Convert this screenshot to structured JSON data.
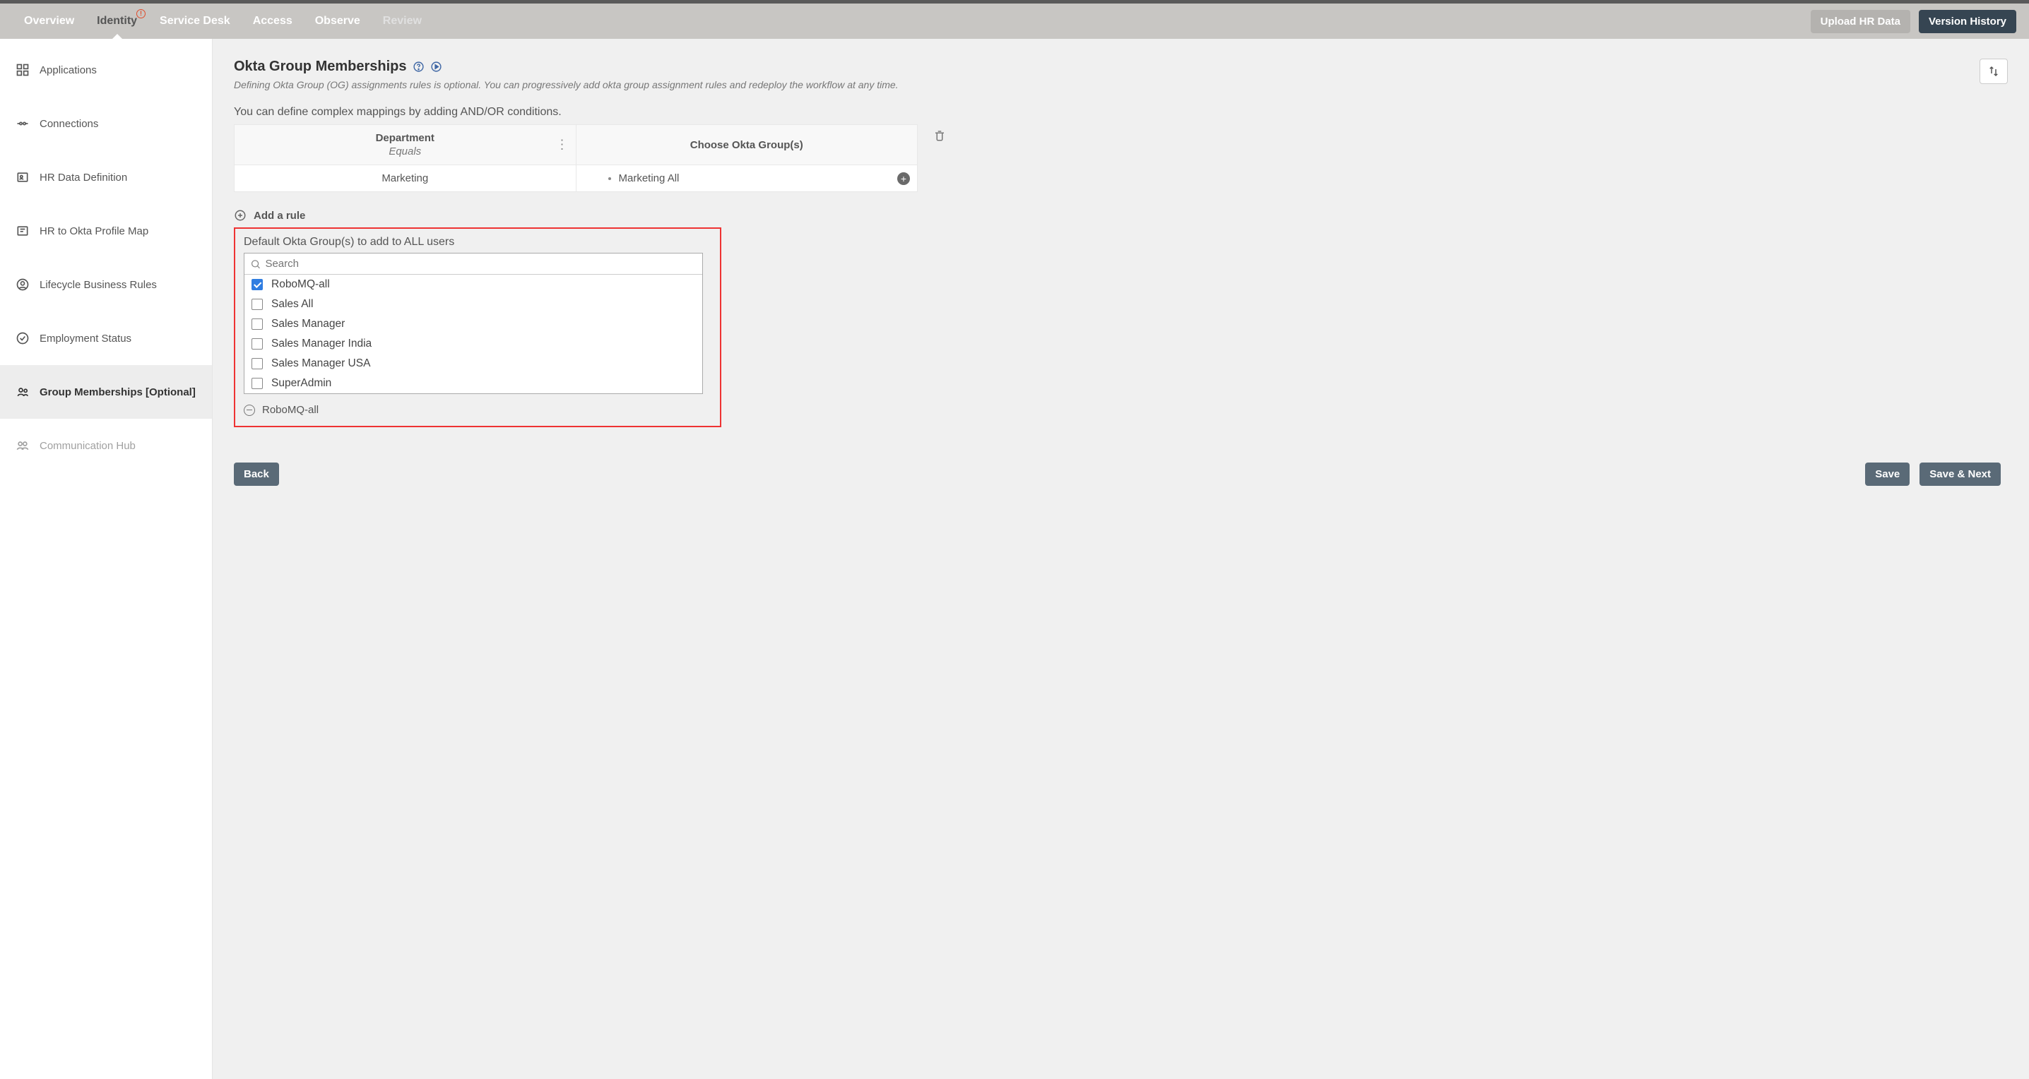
{
  "nav": {
    "tabs": [
      {
        "label": "Overview",
        "state": "normal"
      },
      {
        "label": "Identity",
        "state": "active",
        "alert": "!"
      },
      {
        "label": "Service Desk",
        "state": "normal"
      },
      {
        "label": "Access",
        "state": "normal"
      },
      {
        "label": "Observe",
        "state": "normal"
      },
      {
        "label": "Review",
        "state": "disabled"
      }
    ],
    "upload_btn": "Upload HR Data",
    "history_btn": "Version History"
  },
  "sidebar": {
    "items": [
      {
        "label": "Applications",
        "icon": "grid"
      },
      {
        "label": "Connections",
        "icon": "link"
      },
      {
        "label": "HR Data Definition",
        "icon": "id"
      },
      {
        "label": "HR to Okta Profile Map",
        "icon": "map"
      },
      {
        "label": "Lifecycle Business Rules",
        "icon": "user-circle"
      },
      {
        "label": "Employment Status",
        "icon": "check-circle"
      },
      {
        "label": "Group Memberships [Optional]",
        "icon": "users",
        "active": true
      },
      {
        "label": "Communication Hub",
        "icon": "users2",
        "muted": true
      }
    ]
  },
  "page": {
    "title": "Okta Group Memberships",
    "subtitle": "Defining Okta Group (OG) assignments rules is optional. You can progressively add okta group assignment rules and redeploy the workflow at any time.",
    "mapping_desc": "You can define complex mappings by adding AND/OR conditions.",
    "rule_table": {
      "left_header": "Department",
      "left_sub": "Equals",
      "right_header": "Choose Okta Group(s)",
      "row": {
        "left_value": "Marketing",
        "right_value": "Marketing All"
      }
    },
    "add_rule": "Add a rule",
    "default_label": "Default Okta Group(s) to add to ALL users",
    "search_placeholder": "Search",
    "options": [
      {
        "label": "RoboMQ-all",
        "checked": true
      },
      {
        "label": "Sales All",
        "checked": false
      },
      {
        "label": "Sales Manager",
        "checked": false
      },
      {
        "label": "Sales Manager India",
        "checked": false
      },
      {
        "label": "Sales Manager USA",
        "checked": false
      },
      {
        "label": "SuperAdmin",
        "checked": false
      }
    ],
    "selected_chip": "RoboMQ-all"
  },
  "footer": {
    "back": "Back",
    "save": "Save",
    "save_next": "Save & Next"
  }
}
